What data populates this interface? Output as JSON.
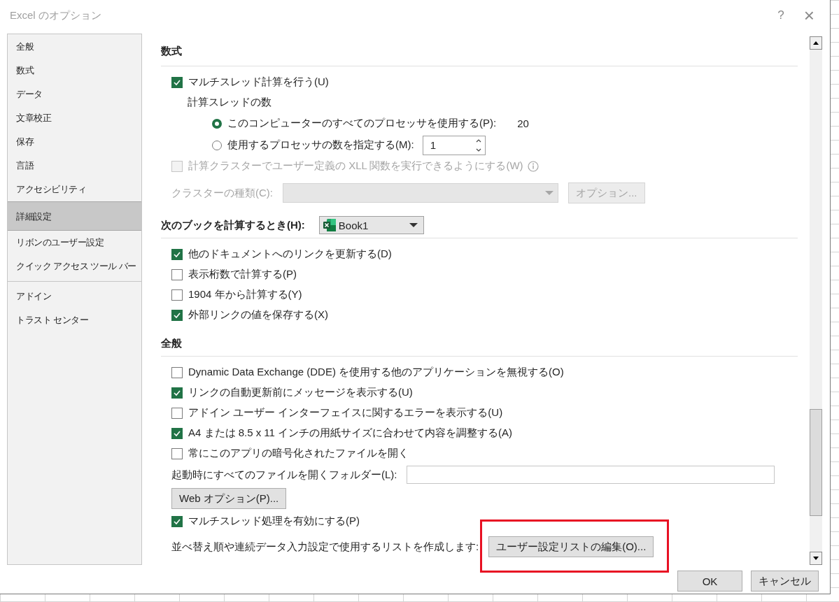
{
  "window": {
    "title": "Excel のオプション",
    "help": "?",
    "close": "×"
  },
  "sidebar": {
    "groups": [
      [
        {
          "label": "全般",
          "selected": false
        },
        {
          "label": "数式",
          "selected": false
        },
        {
          "label": "データ",
          "selected": false
        },
        {
          "label": "文章校正",
          "selected": false
        },
        {
          "label": "保存",
          "selected": false
        },
        {
          "label": "言語",
          "selected": false
        },
        {
          "label": "アクセシビリティ",
          "selected": false
        },
        {
          "label": "詳細設定",
          "selected": true
        }
      ],
      [
        {
          "label": "リボンのユーザー設定",
          "selected": false
        },
        {
          "label": "クイック アクセス ツール バー",
          "selected": false
        }
      ],
      [
        {
          "label": "アドイン",
          "selected": false
        },
        {
          "label": "トラスト センター",
          "selected": false
        }
      ]
    ]
  },
  "sections": [
    {
      "heading": "数式",
      "rows": [
        {
          "kind": "checkbox",
          "label": "マルチスレッド計算を行う(U)",
          "checked": true,
          "children": [
            {
              "kind": "text",
              "label": "計算スレッドの数",
              "children": [
                {
                  "kind": "radio",
                  "label": "このコンピューターのすべてのプロセッサを使用する(P):",
                  "selected": true,
                  "value": "20"
                },
                {
                  "kind": "radio",
                  "label": "使用するプロセッサの数を指定する(M):",
                  "selected": false,
                  "spinner": "1"
                }
              ]
            }
          ]
        },
        {
          "kind": "checkbox",
          "label": "計算クラスターでユーザー定義の XLL 関数を実行できるようにする(W)",
          "checked": false,
          "disabled": true,
          "info": true
        },
        {
          "kind": "select",
          "label": "クラスターの種類(C):",
          "disabled": true,
          "button": "オプション..."
        }
      ]
    },
    {
      "heading": "次のブックを計算するとき(H):",
      "workbook": "Book1",
      "rows": [
        {
          "kind": "checkbox",
          "label": "他のドキュメントへのリンクを更新する(D)",
          "checked": true
        },
        {
          "kind": "checkbox",
          "label": "表示桁数で計算する(P)",
          "checked": false
        },
        {
          "kind": "checkbox",
          "label": "1904 年から計算する(Y)",
          "checked": false
        },
        {
          "kind": "checkbox",
          "label": "外部リンクの値を保存する(X)",
          "checked": true
        }
      ]
    },
    {
      "heading": "全般",
      "rows": [
        {
          "kind": "checkbox",
          "label": "Dynamic Data Exchange (DDE) を使用する他のアプリケーションを無視する(O)",
          "checked": false
        },
        {
          "kind": "checkbox",
          "label": "リンクの自動更新前にメッセージを表示する(U)",
          "checked": true
        },
        {
          "kind": "checkbox",
          "label": "アドイン ユーザー インターフェイスに関するエラーを表示する(U)",
          "checked": false
        },
        {
          "kind": "checkbox",
          "label": "A4 または 8.5 x 11 インチの用紙サイズに合わせて内容を調整する(A)",
          "checked": true
        },
        {
          "kind": "checkbox",
          "label": "常にこのアプリの暗号化されたファイルを開く",
          "checked": false
        },
        {
          "kind": "field",
          "label": "起動時にすべてのファイルを開くフォルダー(L):"
        },
        {
          "kind": "button",
          "label": "Web オプション(P)..."
        },
        {
          "kind": "checkbox",
          "label": "マルチスレッド処理を有効にする(P)",
          "checked": true
        },
        {
          "kind": "label_button",
          "label": "並べ替え順や連続データ入力設定で使用するリストを作成します:",
          "button": "ユーザー設定リストの編集(O)...",
          "highlighted": true
        }
      ]
    }
  ],
  "buttons": [
    "OK",
    "キャンセル"
  ]
}
